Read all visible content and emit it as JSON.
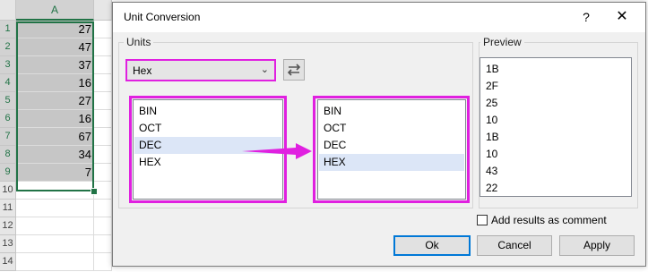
{
  "sheet": {
    "column_header": "A",
    "row_numbers": [
      "1",
      "2",
      "3",
      "4",
      "5",
      "6",
      "7",
      "8",
      "9",
      "10",
      "11",
      "12",
      "13",
      "14"
    ],
    "values": [
      "27",
      "47",
      "37",
      "16",
      "27",
      "16",
      "67",
      "34",
      "7"
    ]
  },
  "dialog": {
    "title": "Unit Conversion",
    "help_label": "?",
    "close_label": "✕",
    "units_group_label": "Units",
    "units_select_value": "Hex",
    "swap_icon": "swap-arrows-icon",
    "from_list": [
      "BIN",
      "OCT",
      "DEC",
      "HEX"
    ],
    "from_selected_index": 2,
    "to_list": [
      "BIN",
      "OCT",
      "DEC",
      "HEX"
    ],
    "to_selected_index": 3,
    "preview_group_label": "Preview",
    "preview_values": [
      "1B",
      "2F",
      "25",
      "10",
      "1B",
      "10",
      "43",
      "22"
    ],
    "checkbox_label": "Add results as comment",
    "checkbox_checked": false,
    "ok_label": "Ok",
    "cancel_label": "Cancel",
    "apply_label": "Apply"
  },
  "colors": {
    "highlight": "#e020e0",
    "selection_green": "#217346",
    "list_selected": "#dce6f7"
  }
}
